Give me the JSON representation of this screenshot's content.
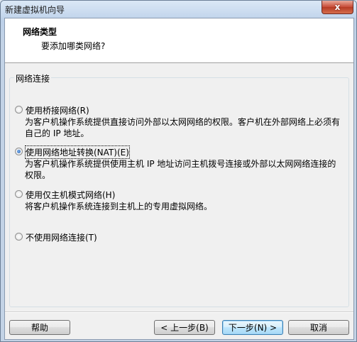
{
  "window": {
    "title": "新建虚拟机向导",
    "close_glyph": "x"
  },
  "header": {
    "title": "网络类型",
    "subtitle": "要添加哪类网络?"
  },
  "group": {
    "legend": "网络连接"
  },
  "options": [
    {
      "label": "使用桥接网络(R)",
      "desc": "为客户机操作系统提供直接访问外部以太网网络的权限。客户机在外部网络上必须有自己的 IP 地址。",
      "checked": false
    },
    {
      "label": "使用网络地址转换(NAT)(E)",
      "desc": "为客户机操作系统提供使用主机 IP 地址访问主机拨号连接或外部以太网网络连接的权限。",
      "checked": true
    },
    {
      "label": "使用仅主机模式网络(H)",
      "desc": "将客户机操作系统连接到主机上的专用虚拟网络。",
      "checked": false
    },
    {
      "label": "不使用网络连接(T)",
      "desc": "",
      "checked": false
    }
  ],
  "buttons": {
    "help": "帮助",
    "back": "< 上一步(B)",
    "next": "下一步(N) >",
    "cancel": "取消"
  }
}
